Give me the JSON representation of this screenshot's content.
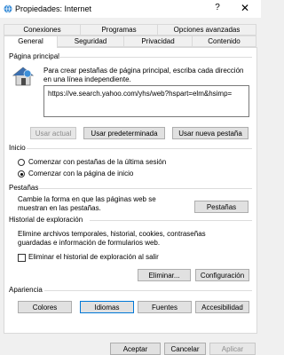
{
  "window": {
    "title": "Propiedades: Internet",
    "help": "?",
    "close": "✕"
  },
  "tabs_row1": [
    {
      "label": "Conexiones"
    },
    {
      "label": "Programas"
    },
    {
      "label": "Opciones avanzadas"
    }
  ],
  "tabs_row2": [
    {
      "label": "General"
    },
    {
      "label": "Seguridad"
    },
    {
      "label": "Privacidad"
    },
    {
      "label": "Contenido"
    }
  ],
  "homepage": {
    "title": "Página principal",
    "description": "Para crear pestañas de página principal, escriba cada dirección en una línea independiente.",
    "url": "https://ve.search.yahoo.com/yhs/web?hspart=elm&hsimp=",
    "use_current": "Usar actual",
    "use_default": "Usar predeterminada",
    "use_new_tab": "Usar nueva pestaña"
  },
  "startup": {
    "title": "Inicio",
    "option1": "Comenzar con pestañas de la última sesión",
    "option2": "Comenzar con la página de inicio"
  },
  "tabs_section": {
    "title": "Pestañas",
    "description": "Cambie la forma en que las páginas web se muestran en las pestañas.",
    "button": "Pestañas"
  },
  "history": {
    "title": "Historial de exploración",
    "description": "Elimine archivos temporales, historial, cookies, contraseñas guardadas e información de formularios web.",
    "checkbox": "Eliminar el historial de exploración al salir",
    "delete_button": "Eliminar...",
    "settings_button": "Configuración"
  },
  "appearance": {
    "title": "Apariencia",
    "colors": "Colores",
    "languages": "Idiomas",
    "fonts": "Fuentes",
    "accessibility": "Accesibilidad"
  },
  "footer": {
    "accept": "Aceptar",
    "cancel": "Cancelar",
    "apply": "Aplicar"
  }
}
